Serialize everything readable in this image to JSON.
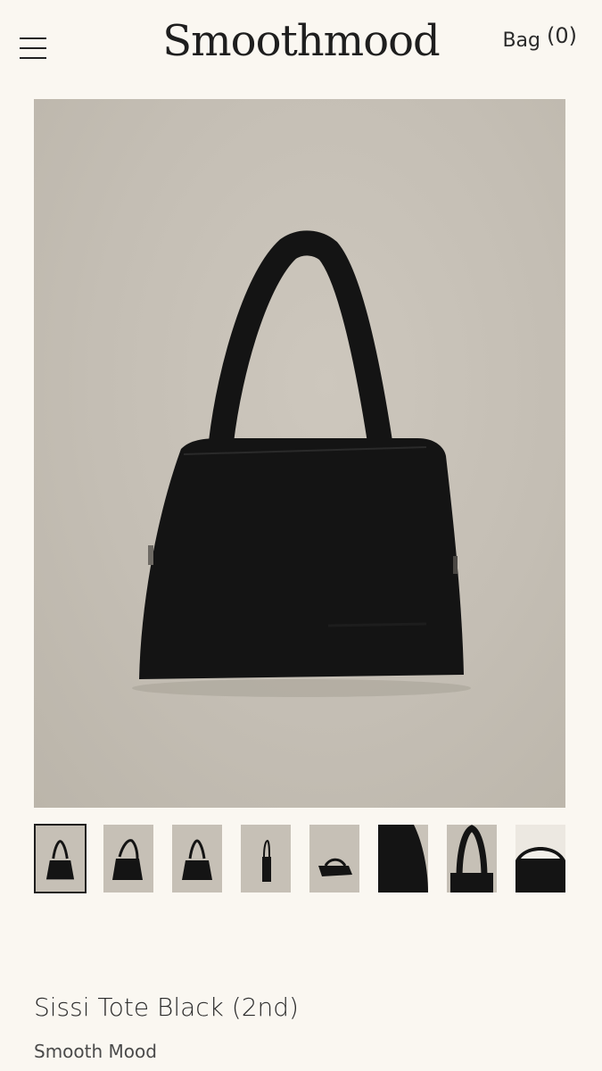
{
  "header": {
    "logo": "Smoothmood",
    "bag_label": "Bag",
    "bag_count": "(0)"
  },
  "product": {
    "title": "Sissi Tote Black (2nd)",
    "brand": "Smooth Mood",
    "thumbnail_count": 8,
    "selected_thumbnail": 1
  },
  "colors": {
    "page_bg": "#faf7f1",
    "photo_bg": "#c4beb4",
    "bag_black": "#141414"
  },
  "icons": {
    "menu": "hamburger-icon"
  }
}
